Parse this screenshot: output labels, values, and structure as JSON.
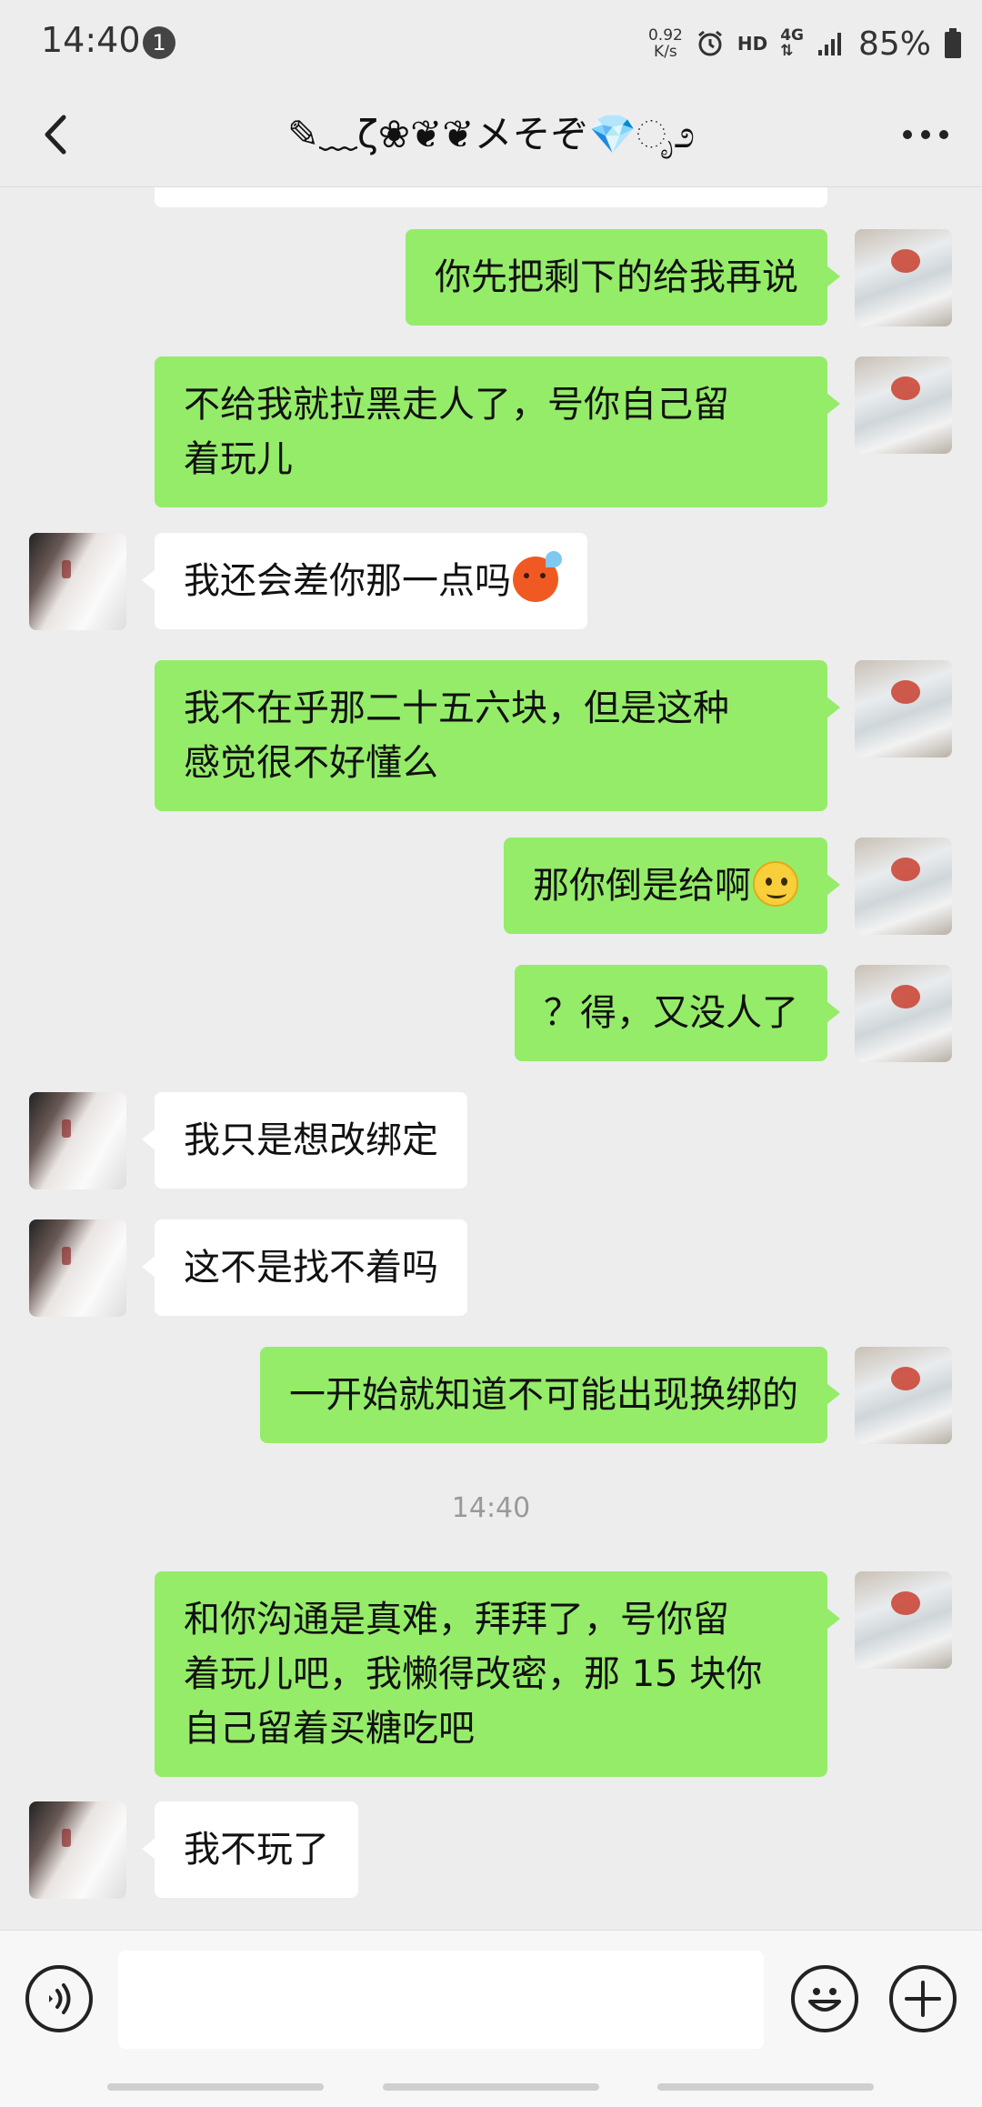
{
  "status_bar": {
    "time": "14:40",
    "notification_count": "1",
    "net_speed_value": "0.92",
    "net_speed_unit": "K/s",
    "hd": "HD",
    "network": "4G",
    "battery": "85%"
  },
  "header": {
    "title": "✎﹏ζ❀❦❦メそぞ💎ೃ೨"
  },
  "messages": [
    {
      "side": "self",
      "text": "你先把剩下的给我再说"
    },
    {
      "side": "self",
      "text_line1": "不给我就拉黑走人了，号你自己留",
      "text_line2": "着玩儿"
    },
    {
      "side": "other",
      "text": "我还会差你那一点吗",
      "emoji": "cold-sweat-emoji"
    },
    {
      "side": "self",
      "text_line1": "我不在乎那二十五六块，但是这种",
      "text_line2": "感觉很不好懂么"
    },
    {
      "side": "self",
      "text": "那你倒是给啊",
      "emoji": "smile-emoji"
    },
    {
      "side": "self",
      "text": "？得，又没人了"
    },
    {
      "side": "other",
      "text": "我只是想改绑定"
    },
    {
      "side": "other",
      "text": "这不是找不着吗"
    },
    {
      "side": "self",
      "text": "一开始就知道不可能出现换绑的"
    },
    {
      "side": "self",
      "text_line1": "和你沟通是真难，拜拜了，号你留",
      "text_line2": "着玩儿吧，我懒得改密，那 15 块你",
      "text_line3": "自己留着买糖吃吧"
    },
    {
      "side": "other",
      "text": "我不玩了"
    }
  ],
  "timestamp": "14:40",
  "input": {
    "value": "",
    "placeholder": ""
  },
  "colors": {
    "self_bubble": "#95ec69",
    "other_bubble": "#ffffff",
    "chat_background": "#ededed"
  }
}
